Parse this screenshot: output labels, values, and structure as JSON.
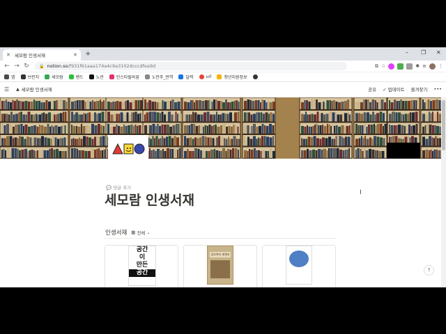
{
  "browser": {
    "tab_title": "세모람 인생서재",
    "url_host": "notion.so",
    "url_path": "/f931f61aaa174a4c9a3102dcccdfea9d"
  },
  "bookmarks": [
    {
      "label": "앱",
      "color": "#4a4a4a"
    },
    {
      "label": "브런치",
      "color": "#333333"
    },
    {
      "label": "세모람",
      "color": "#34a853"
    },
    {
      "label": "밴드",
      "color": "#2dbd3a"
    },
    {
      "label": "노션",
      "color": "#111111"
    },
    {
      "label": "인스타릴바꿈",
      "color": "#e1306c"
    },
    {
      "label": "노안주_반역",
      "color": "#888888"
    },
    {
      "label": "달력",
      "color": "#1a73e8"
    },
    {
      "label": "url",
      "color": "#ea4335"
    },
    {
      "label": "청년지원정보",
      "color": "#f4b400"
    },
    {
      "label": "",
      "color": "#333333"
    }
  ],
  "notion": {
    "breadcrumb": "세모람 인생서재",
    "share": "공유",
    "updates": "업데이트",
    "favorite": "즐겨찾기",
    "more": "•••",
    "add_comment": "댓글 추가",
    "page_title": "세모람 인생서재",
    "db_title": "인생서재",
    "db_view": "전체",
    "help": "?"
  },
  "books": [
    {
      "cover_lines": [
        "공간",
        "이",
        "만든",
        "공간"
      ]
    },
    {
      "cover_lines": [
        "공부하지 세계사"
      ]
    },
    {
      "cover_lines": [
        ""
      ]
    }
  ]
}
